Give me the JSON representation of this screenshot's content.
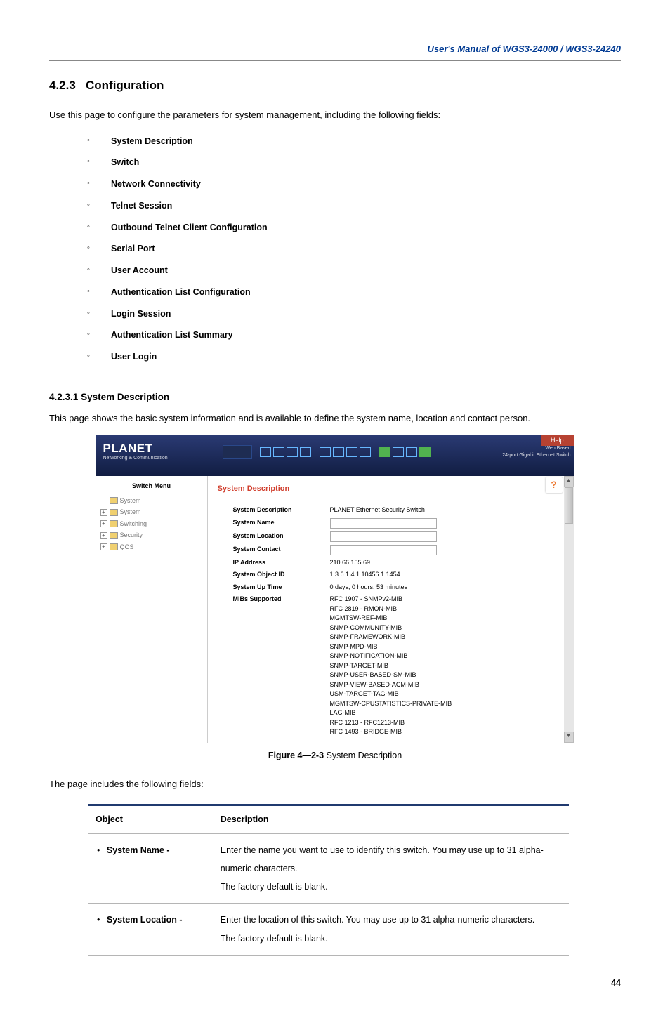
{
  "header": "User's Manual of WGS3-24000 / WGS3-24240",
  "section_num": "4.2.3",
  "section_title": "Configuration",
  "intro": "Use this page to configure the parameters for system management, including the following fields:",
  "config_items": [
    "System Description",
    "Switch",
    "Network Connectivity",
    "Telnet Session",
    "Outbound Telnet Client Configuration",
    "Serial Port",
    "User Account",
    "Authentication List Configuration",
    "Login Session",
    "Authentication List Summary",
    "User Login"
  ],
  "subsection_num": "4.2.3.1",
  "subsection_title": "System Description",
  "subsection_para": "This page shows the basic system information and is available to define the system name, location and contact person.",
  "figure_caption_bold": "Figure 4—2-3",
  "figure_caption_rest": " System Description",
  "table_intro": "The page includes the following fields:",
  "table_headers": {
    "object": "Object",
    "description": "Description"
  },
  "table_rows": [
    {
      "object": "System Name -",
      "desc": "Enter the name you want to use to identify this switch. You may use up to 31 alpha-numeric characters.\nThe factory default is blank."
    },
    {
      "object": "System Location -",
      "desc": "Enter the location of this switch. You may use up to 31 alpha-numeric characters.\nThe factory default is blank."
    }
  ],
  "page_number": "44",
  "shot": {
    "help": "Help",
    "logo": "PLANET",
    "logo_sub": "Networking & Communication",
    "corner1": "Web Based",
    "corner2": "24-port Gigabit Ethernet Switch",
    "sidebar_title": "Switch Menu",
    "tree": [
      "System",
      "System",
      "Switching",
      "Security",
      "QOS"
    ],
    "panel_title": "System Description",
    "rows": {
      "sys_desc_lab": "System Description",
      "sys_desc_val": "PLANET Ethernet Security Switch",
      "sys_name_lab": "System Name",
      "sys_loc_lab": "System Location",
      "sys_con_lab": "System Contact",
      "ip_lab": "IP Address",
      "ip_val": "210.66.155.69",
      "oid_lab": "System Object ID",
      "oid_val": "1.3.6.1.4.1.10456.1.1454",
      "up_lab": "System Up Time",
      "up_val": "0 days, 0 hours, 53 minutes",
      "mibs_lab": "MIBs Supported",
      "mibs_val": "RFC 1907 - SNMPv2-MIB\nRFC 2819 - RMON-MIB\nMGMTSW-REF-MIB\nSNMP-COMMUNITY-MIB\nSNMP-FRAMEWORK-MIB\nSNMP-MPD-MIB\nSNMP-NOTIFICATION-MIB\nSNMP-TARGET-MIB\nSNMP-USER-BASED-SM-MIB\nSNMP-VIEW-BASED-ACM-MIB\nUSM-TARGET-TAG-MIB\nMGMTSW-CPUSTATISTICS-PRIVATE-MIB\nLAG-MIB\nRFC 1213 - RFC1213-MIB\nRFC 1493 - BRIDGE-MIB"
    }
  }
}
